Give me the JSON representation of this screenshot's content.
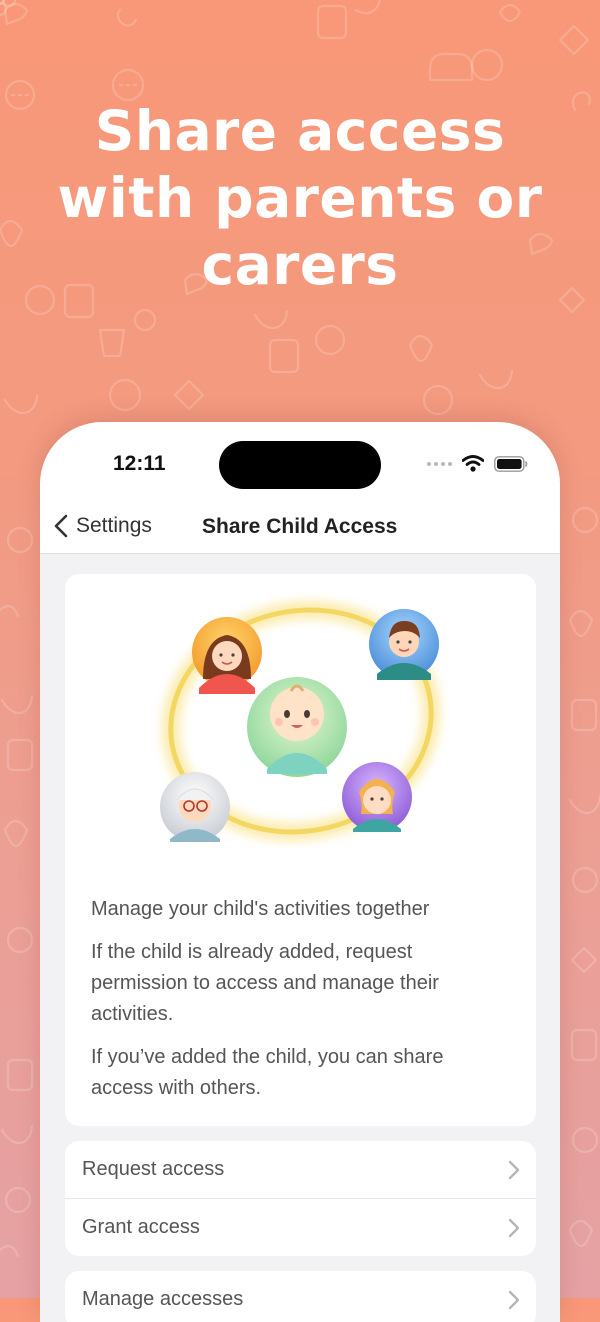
{
  "headline": {
    "line1": "Share access",
    "line2": "with parents or",
    "line3": "carers"
  },
  "status_bar": {
    "time": "12:11"
  },
  "navbar": {
    "back_label": "Settings",
    "title": "Share Child Access"
  },
  "info_card": {
    "heading": "Manage your child's activities together",
    "paragraph1": "If the child is already added, request permission to access and manage their activities.",
    "paragraph2": "If you’ve added the child, you can share access with others."
  },
  "actions": {
    "request_access": "Request access",
    "grant_access": "Grant access",
    "manage_accesses": "Manage accesses"
  },
  "icons": {
    "back": "chevron-left-icon",
    "row": "chevron-right-icon",
    "wifi": "wifi-icon",
    "battery": "battery-icon"
  },
  "colors": {
    "background_top": "#f89878",
    "background_bottom": "#e5a1a4",
    "headline": "#ffffff",
    "ring": "#f7e08a"
  }
}
